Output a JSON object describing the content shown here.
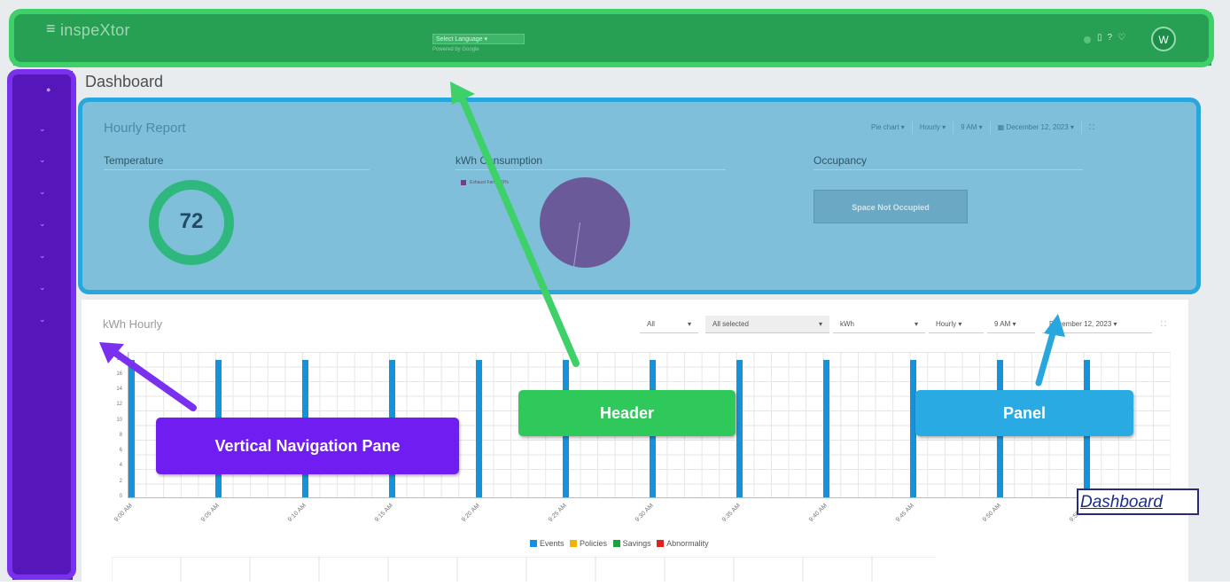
{
  "header": {
    "brand": "inspeXtor",
    "menu_icon": "hamburger-icon",
    "language_select": "Select Language",
    "language_powered": "Powered by Google",
    "icons": [
      "status-dot",
      "mobile-icon",
      "help-icon",
      "bell-icon"
    ],
    "avatar_initials": "W"
  },
  "sidebar": {
    "items": [
      "home-icon",
      "chevron-down-icon",
      "chevron-down-icon",
      "chevron-down-icon",
      "chevron-down-icon",
      "chevron-down-icon",
      "chevron-down-icon",
      "chevron-down-icon"
    ]
  },
  "page": {
    "title": "Dashboard"
  },
  "hourly_report": {
    "title": "Hourly Report",
    "controls": [
      "Pie chart ▾",
      "Hourly ▾",
      "9 AM ▾",
      "December 12, 2023 ▾"
    ],
    "temperature": {
      "title": "Temperature",
      "value": "72"
    },
    "kwh": {
      "title": "kWh Consumption",
      "legend": "Exhaust Fan: 100%"
    },
    "occupancy": {
      "title": "Occupancy",
      "status_button": "Space Not Occupied"
    }
  },
  "kwh_hourly": {
    "title": "kWh Hourly",
    "filters": [
      "All",
      "All selected",
      "kWh",
      "Hourly",
      "9 AM",
      "December 12, 2023"
    ],
    "legend": [
      {
        "label": "Events",
        "color": "#1592d9"
      },
      {
        "label": "Policies",
        "color": "#f0b400"
      },
      {
        "label": "Savings",
        "color": "#1aa33a"
      },
      {
        "label": "Abnormality",
        "color": "#e0211c"
      }
    ]
  },
  "chart_data": {
    "type": "bar",
    "categories": [
      "9:00 AM",
      "9:05 AM",
      "9:10 AM",
      "9:15 AM",
      "9:20 AM",
      "9:25 AM",
      "9:30 AM",
      "9:35 AM",
      "9:40 AM",
      "9:45 AM",
      "9:50 AM",
      "9:55 AM"
    ],
    "series": [
      {
        "name": "Events",
        "values": [
          18,
          18,
          18,
          18,
          18,
          18,
          18,
          18,
          18,
          18,
          18,
          18
        ]
      }
    ],
    "y_ticks": [
      "0",
      "2",
      "4",
      "6",
      "8",
      "10",
      "12",
      "14",
      "16",
      "18"
    ],
    "ylim": [
      0,
      19
    ]
  },
  "annotations": {
    "header": "Header",
    "nav": "Vertical Navigation Pane",
    "panel": "Panel",
    "caption": "Dashboard",
    "colors": {
      "header": "#3ed069",
      "nav": "#7a30ef",
      "panel": "#28a6de"
    }
  }
}
